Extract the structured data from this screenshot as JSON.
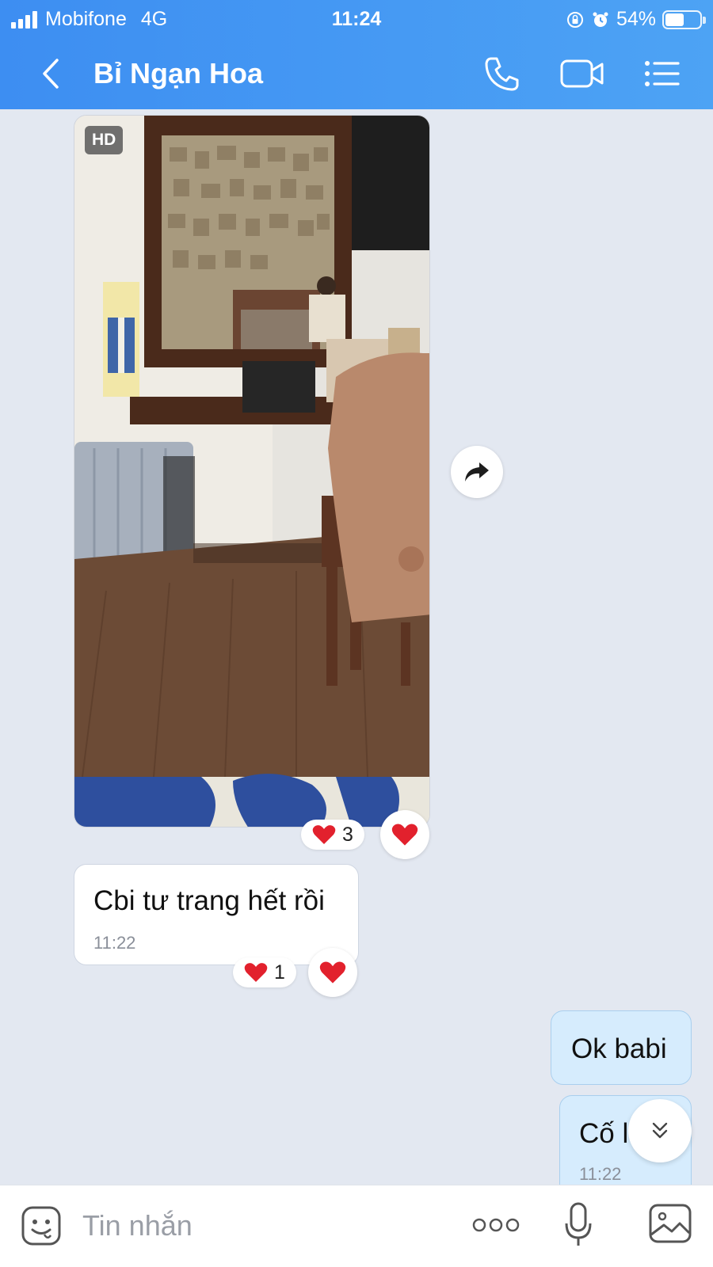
{
  "status_bar": {
    "carrier": "Mobifone",
    "network": "4G",
    "time": "11:24",
    "battery": "54%",
    "battery_level": 0.54
  },
  "header": {
    "title": "Bỉ Ngạn Hoa",
    "icons": [
      "back-icon",
      "phone-icon",
      "video-call-icon",
      "menu-list-icon"
    ]
  },
  "messages": {
    "photo": {
      "badge": "HD",
      "reaction_count": "3",
      "description_icon": "photo-message"
    },
    "text1": {
      "text": "Cbi tư trang hết rồi",
      "time": "11:22",
      "reaction_count": "1"
    },
    "out1": {
      "text": "Ok babi"
    },
    "out2": {
      "text": "Cố l",
      "time": "11:22"
    }
  },
  "input": {
    "placeholder": "Tin nhắn",
    "icons": [
      "sticker-icon",
      "more-icon",
      "microphone-icon",
      "image-icon"
    ]
  },
  "colors": {
    "header": "#4a9df4",
    "background": "#e3e8f1",
    "outgoing_bubble": "#d6ecfd",
    "heart": "#e2212d"
  }
}
